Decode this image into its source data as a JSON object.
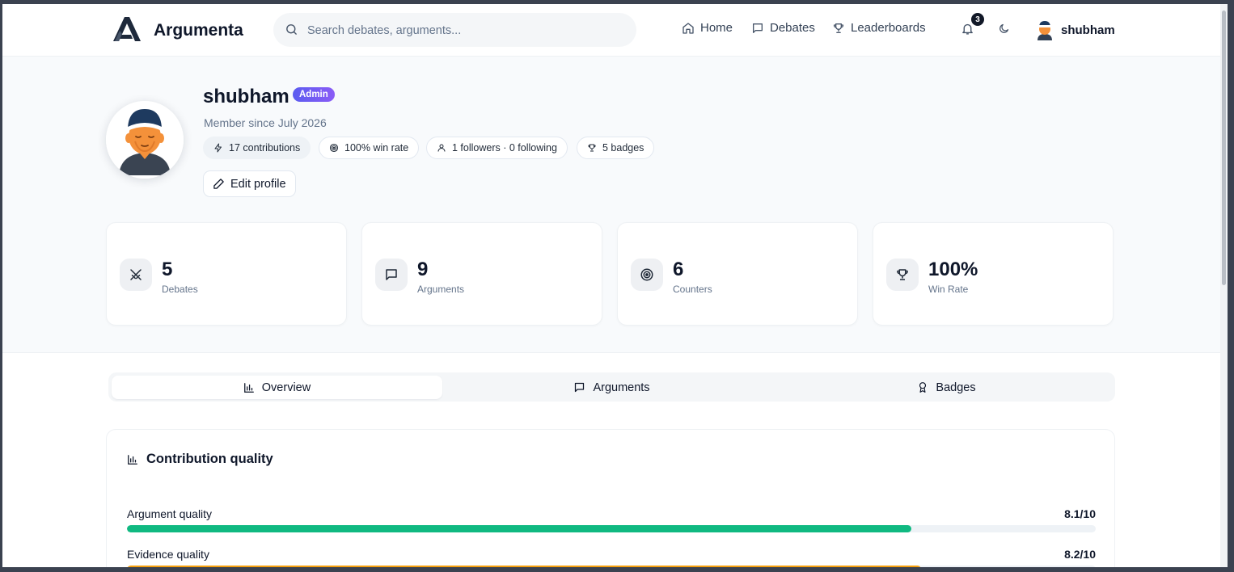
{
  "brand": {
    "name": "Argumenta"
  },
  "search": {
    "placeholder": "Search debates, arguments..."
  },
  "nav": {
    "home": "Home",
    "debates": "Debates",
    "leaderboards": "Leaderboards"
  },
  "notifications": {
    "count": "3"
  },
  "user": {
    "name": "shubham"
  },
  "profile": {
    "name": "shubham",
    "role_badge": "Admin",
    "member_since": "Member since July 2026",
    "chips": {
      "contributions": "17 contributions",
      "win_rate": "100% win rate",
      "follow": "1 followers · 0 following",
      "badges": "5 badges"
    },
    "edit_label": "Edit profile"
  },
  "stats": [
    {
      "value": "5",
      "label": "Debates",
      "icon": "crossed-swords-icon"
    },
    {
      "value": "9",
      "label": "Arguments",
      "icon": "message-square-icon"
    },
    {
      "value": "6",
      "label": "Counters",
      "icon": "target-icon"
    },
    {
      "value": "100%",
      "label": "Win Rate",
      "icon": "trophy-icon"
    }
  ],
  "tabs": [
    {
      "label": "Overview",
      "icon": "bar-chart-icon",
      "active": true
    },
    {
      "label": "Arguments",
      "icon": "message-square-icon",
      "active": false
    },
    {
      "label": "Badges",
      "icon": "award-icon",
      "active": false
    }
  ],
  "quality": {
    "title": "Contribution quality",
    "rows": [
      {
        "label": "Argument quality",
        "value": "8.1/10",
        "score": 8.1,
        "color": "#10b981"
      },
      {
        "label": "Evidence quality",
        "value": "8.2/10",
        "score": 8.2,
        "color": "#f59e0b"
      }
    ]
  },
  "colors": {
    "accent": "#6366f1",
    "page_bg": "#f8fafc",
    "text": "#0f172a"
  }
}
